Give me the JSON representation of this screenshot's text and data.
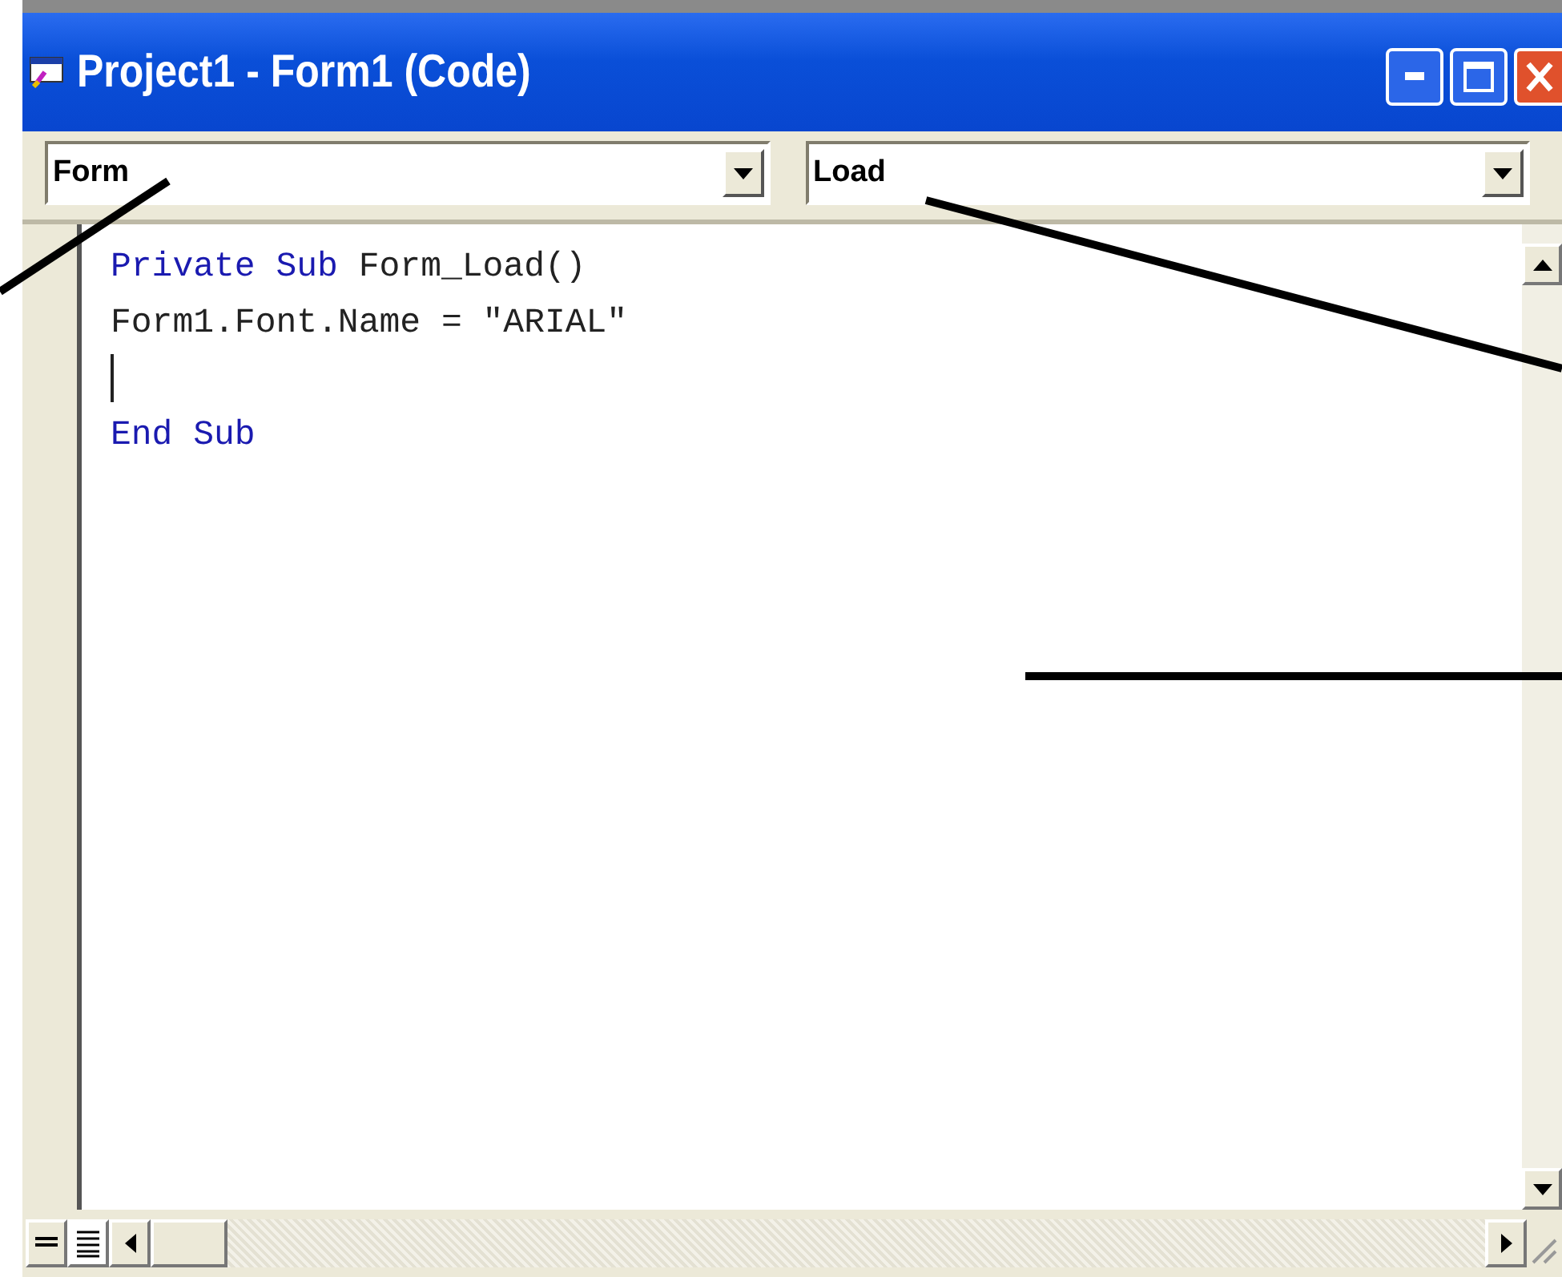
{
  "window": {
    "title": "Project1 - Form1 (Code)"
  },
  "object_combo": {
    "value": "Form"
  },
  "procedure_combo": {
    "value": "Load"
  },
  "code": {
    "lines": [
      {
        "cursor": false,
        "tokens": [
          {
            "text": "Private",
            "kind": "keyword"
          },
          {
            "text": "Sub",
            "kind": "keyword"
          },
          {
            "text": "Form_Load()",
            "kind": "plain"
          }
        ]
      },
      {
        "cursor": false,
        "tokens": [
          {
            "text": "Form1.Font.Name",
            "kind": "plain"
          },
          {
            "text": "=",
            "kind": "plain"
          },
          {
            "text": "\"ARIAL\"",
            "kind": "plain"
          }
        ]
      },
      {
        "cursor": true
      },
      {
        "cursor": false,
        "tokens": [
          {
            "text": "End",
            "kind": "keyword"
          },
          {
            "text": "Sub",
            "kind": "keyword"
          }
        ]
      }
    ]
  }
}
